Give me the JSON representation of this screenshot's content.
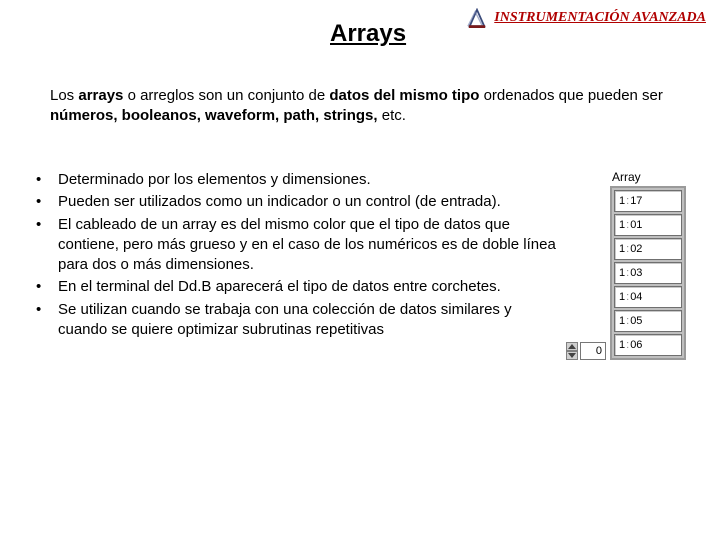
{
  "header": {
    "course_title": "INSTRUMENTACIÓN AVANZADA"
  },
  "title": " Arrays",
  "intro": {
    "pre": "Los ",
    "b1": "arrays",
    "mid1": " o arreglos son  un conjunto de ",
    "b2": "datos del mismo tipo",
    "mid2": " ordenados que pueden ser ",
    "b3": "números, booleanos, waveform, path, strings,",
    "post": " etc."
  },
  "bullets": [
    "Determinado por los elementos y dimensiones.",
    "Pueden ser utilizados como un indicador o un control (de entrada).",
    "El cableado de un array es del mismo color que el tipo de datos que contiene, pero más grueso y en el caso de los numéricos es de doble línea para dos o más dimensiones.",
    "En el terminal del Dd.B aparecerá el tipo de datos entre corchetes.",
    "Se utilizan cuando se trabaja con una colección de datos similares y cuando se quiere optimizar subrutinas repetitivas"
  ],
  "labview": {
    "label": "Array",
    "index": "0",
    "cells": [
      {
        "h": "1",
        "m": "17"
      },
      {
        "h": "1",
        "m": "01"
      },
      {
        "h": "1",
        "m": "02"
      },
      {
        "h": "1",
        "m": "03"
      },
      {
        "h": "1",
        "m": "04"
      },
      {
        "h": "1",
        "m": "05"
      },
      {
        "h": "1",
        "m": "06"
      }
    ]
  }
}
